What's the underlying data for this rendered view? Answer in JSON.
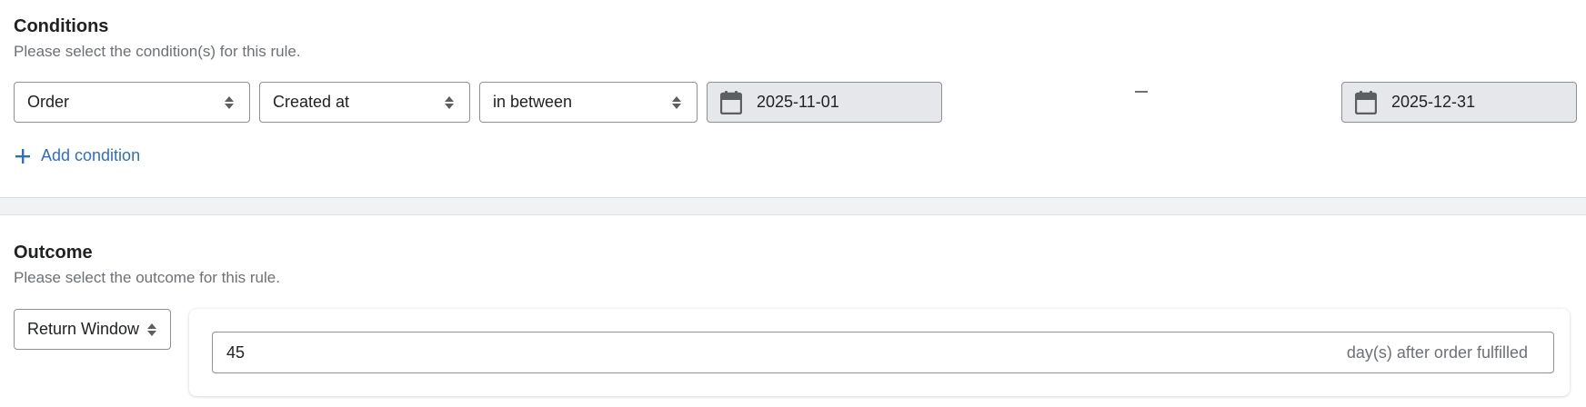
{
  "conditions": {
    "title": "Conditions",
    "subtitle": "Please select the condition(s) for this rule.",
    "row": {
      "entity": "Order",
      "field": "Created at",
      "operator": "in between",
      "start_date": "2025-11-01",
      "range_separator": "–",
      "end_date": "2025-12-31"
    },
    "add_condition_label": "Add condition"
  },
  "outcome": {
    "title": "Outcome",
    "subtitle": "Please select the outcome for this rule.",
    "type": "Return Window",
    "days_value": "45",
    "days_suffix": "day(s) after order fulfilled"
  },
  "colors": {
    "accent": "#2c6ecb",
    "date_field_bg": "#e6e7ea",
    "divider_bg": "#f1f2f4"
  }
}
